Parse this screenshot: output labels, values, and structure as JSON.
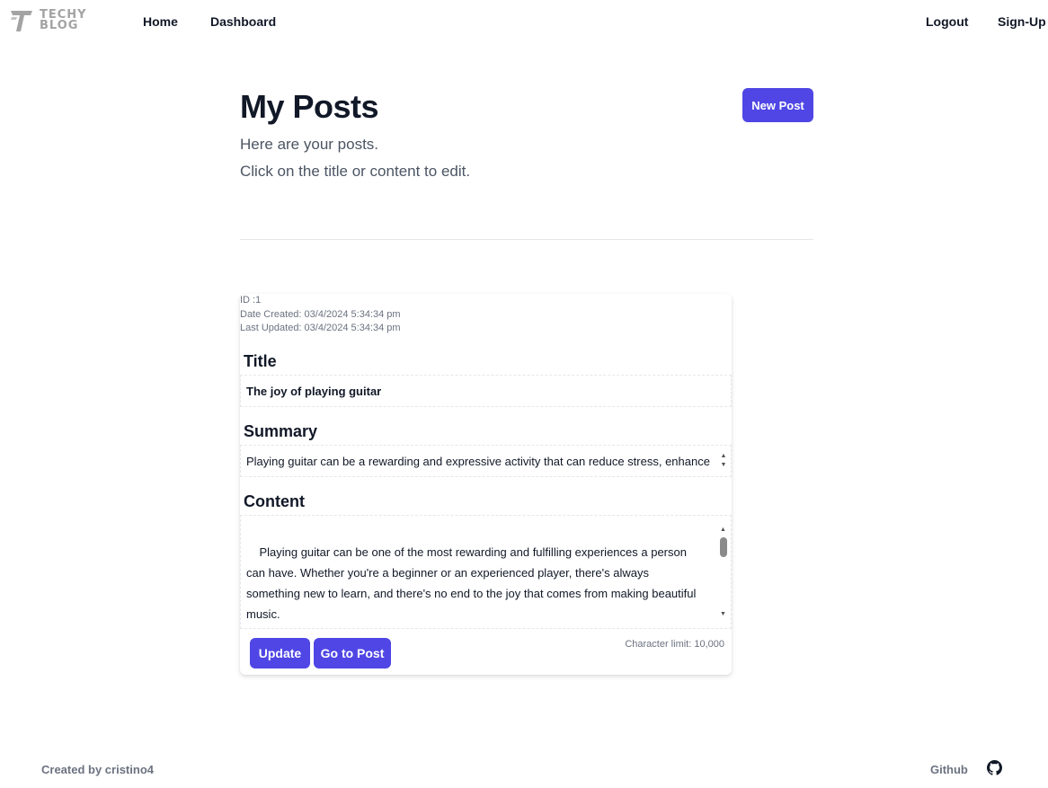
{
  "header": {
    "logo_text_line1": "TECHY",
    "logo_text_line2": "BLOG",
    "nav_left": [
      "Home",
      "Dashboard"
    ],
    "nav_right": [
      "Logout",
      "Sign-Up"
    ]
  },
  "hero": {
    "title": "My Posts",
    "subtitle_line1": "Here are your posts.",
    "subtitle_line2": "Click on the title or content to edit.",
    "new_post_label": "New Post"
  },
  "post": {
    "id_text": "ID :1",
    "date_created": "Date Created: 03/4/2024 5:34:34 pm",
    "last_updated": "Last Updated: 03/4/2024 5:34:34 pm",
    "title_label": "Title",
    "title_value": "The joy of playing guitar",
    "summary_label": "Summary",
    "summary_value": "Playing guitar can be a rewarding and expressive activity that can reduce stress, enhance",
    "content_label": "Content",
    "content_value": "Playing guitar can be one of the most rewarding and fulfilling experiences a person can have. Whether you're a beginner or an experienced player, there's always something new to learn, and there's no end to the joy that comes from making beautiful music.\n                            For beginners, learning to play guitar may seem daunting at first, but with regular practice and dedication, anyone can become proficient. As you begin to",
    "char_limit": "Character limit: 10,000",
    "update_label": "Update",
    "goto_label": "Go to Post"
  },
  "footer": {
    "credit": "Created by cristino4",
    "github_label": "Github"
  },
  "colors": {
    "accent": "#4f46e5",
    "muted_text": "#6b7280",
    "heading": "#111827"
  },
  "icons": [
    "techy-blog-logo-icon",
    "github-icon",
    "scroll-up-icon",
    "scroll-down-icon"
  ]
}
